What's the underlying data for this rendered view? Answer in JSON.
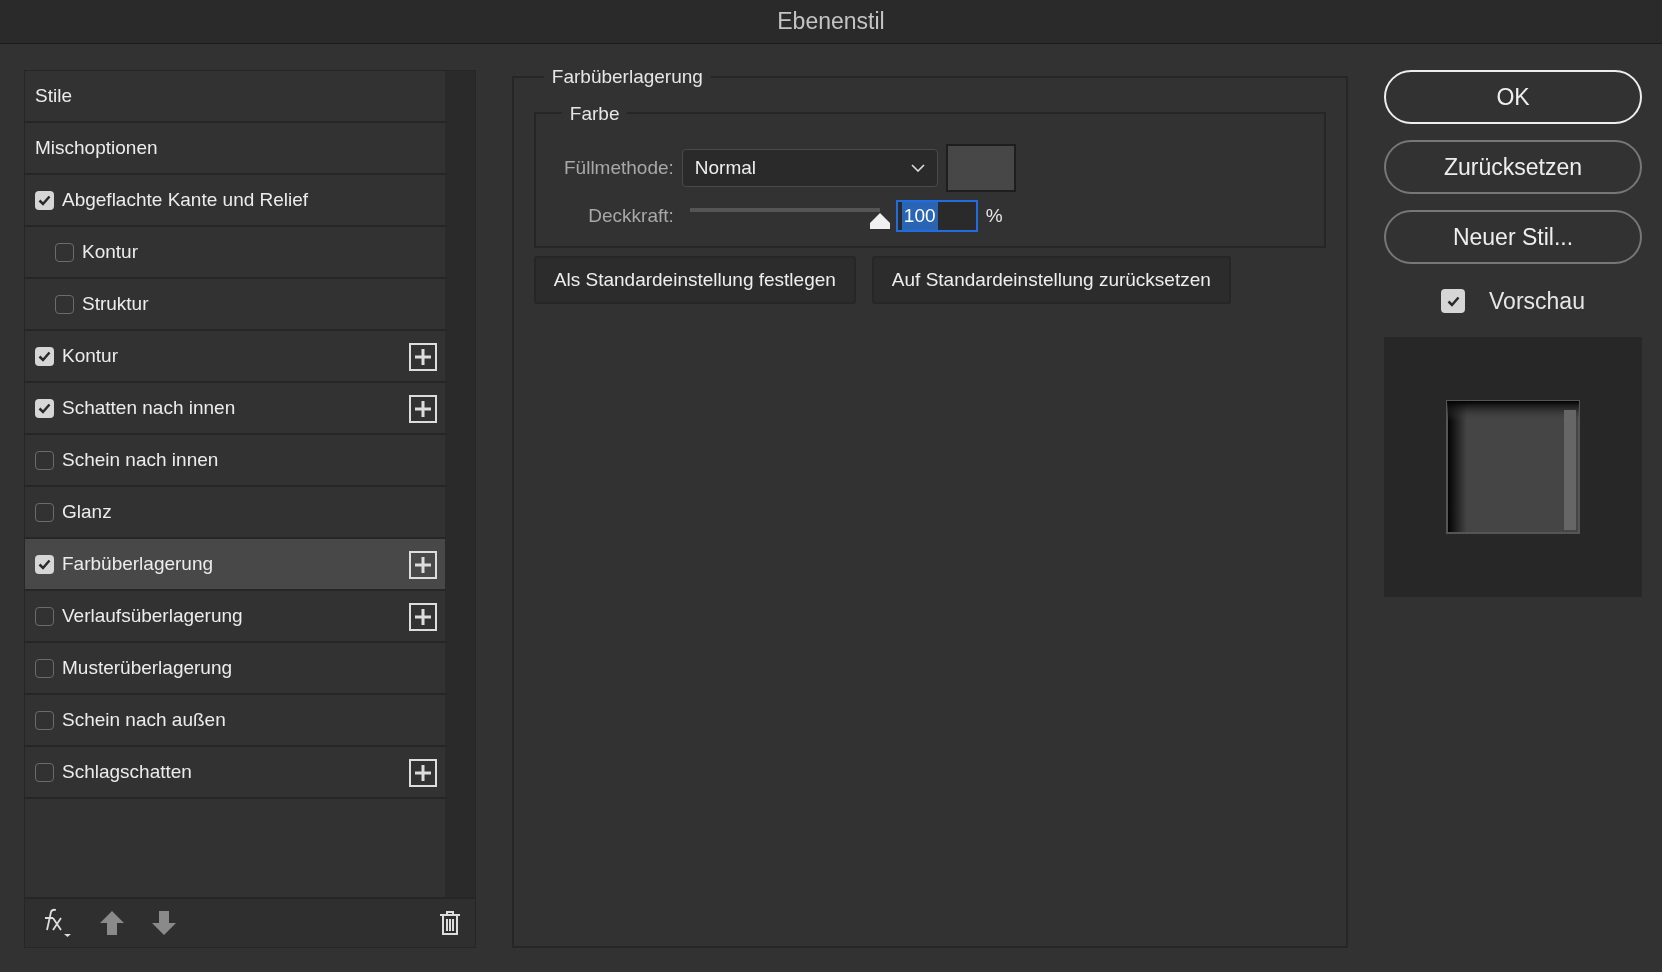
{
  "window": {
    "title": "Ebenenstil"
  },
  "styles_list": [
    {
      "kind": "header",
      "label": "Stile",
      "selected": false
    },
    {
      "kind": "header",
      "label": "Mischoptionen",
      "selected": false
    },
    {
      "kind": "effect",
      "label": "Abgeflachte Kante und Relief",
      "checked": true,
      "selected": false,
      "has_add": false,
      "children": [
        {
          "kind": "effect",
          "label": "Kontur",
          "checked": false,
          "selected": false,
          "has_add": false
        },
        {
          "kind": "effect",
          "label": "Struktur",
          "checked": false,
          "selected": false,
          "has_add": false
        }
      ]
    },
    {
      "kind": "effect",
      "label": "Kontur",
      "checked": true,
      "selected": false,
      "has_add": true
    },
    {
      "kind": "effect",
      "label": "Schatten nach innen",
      "checked": true,
      "selected": false,
      "has_add": true
    },
    {
      "kind": "effect",
      "label": "Schein nach innen",
      "checked": false,
      "selected": false,
      "has_add": false
    },
    {
      "kind": "effect",
      "label": "Glanz",
      "checked": false,
      "selected": false,
      "has_add": false
    },
    {
      "kind": "effect",
      "label": "Farbüberlagerung",
      "checked": true,
      "selected": true,
      "has_add": true
    },
    {
      "kind": "effect",
      "label": "Verlaufsüberlagerung",
      "checked": false,
      "selected": false,
      "has_add": true
    },
    {
      "kind": "effect",
      "label": "Musterüberlagerung",
      "checked": false,
      "selected": false,
      "has_add": false
    },
    {
      "kind": "effect",
      "label": "Schein nach außen",
      "checked": false,
      "selected": false,
      "has_add": false
    },
    {
      "kind": "effect",
      "label": "Schlagschatten",
      "checked": false,
      "selected": false,
      "has_add": true
    }
  ],
  "settings": {
    "title": "Farbüberlagerung",
    "group_title": "Farbe",
    "blend_label": "Füllmethode:",
    "blend_value": "Normal",
    "opacity_label": "Deckkraft:",
    "opacity": {
      "level": 1.0,
      "value": "100",
      "unit": "%"
    },
    "buttons": [
      "Als Standardeinstellung festlegen",
      "Auf Standardeinstellung zurücksetzen"
    ]
  },
  "actions": [
    {
      "label": "OK",
      "default": true
    },
    {
      "label": "Zurücksetzen",
      "default": false
    },
    {
      "label": "Neuer Stil...",
      "default": false
    }
  ],
  "preview": {
    "label": "Vorschau",
    "checked": true
  }
}
